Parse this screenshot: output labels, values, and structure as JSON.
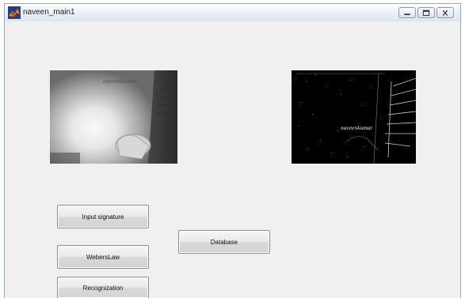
{
  "window": {
    "title": "naveen_main1",
    "controls": [
      {
        "name": "minimize",
        "icon": "minimize-icon"
      },
      {
        "name": "maximize",
        "icon": "maximize-icon"
      },
      {
        "name": "close",
        "icon": "close-icon"
      }
    ]
  },
  "images": {
    "input": {
      "icon": "signature-photo",
      "handwriting": "naveenkumar"
    },
    "processed": {
      "icon": "edge-map",
      "handwriting": "naveenkumar"
    }
  },
  "buttons": {
    "input_signature": "Input signature",
    "webers_law": "WebersLaw",
    "recognization": "Recognization",
    "database": "Database"
  },
  "colors": {
    "window_bg": "#f0f0f0",
    "button_border": "#8e8f8f",
    "processed_bg": "#000000"
  }
}
